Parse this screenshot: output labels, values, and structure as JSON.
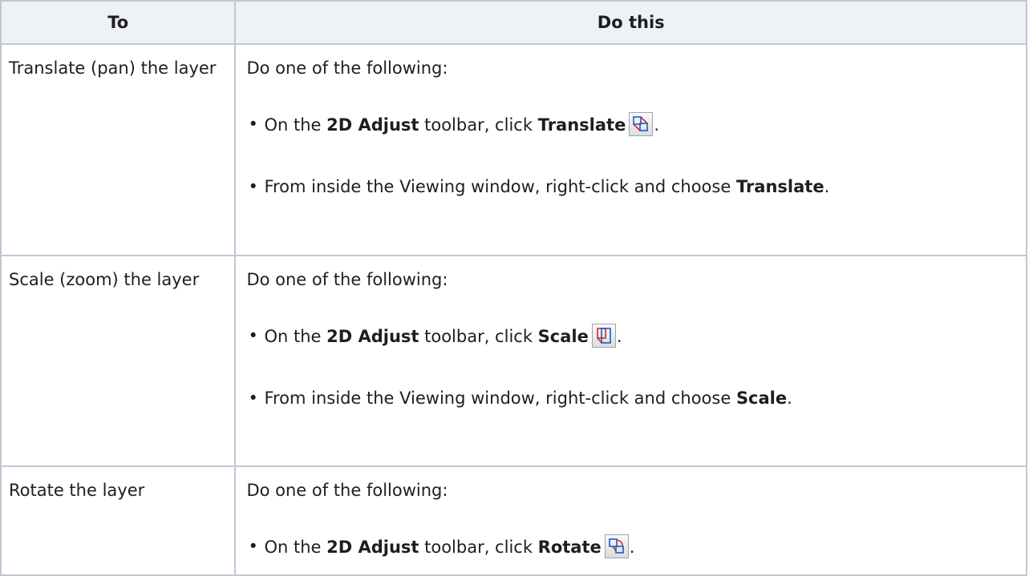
{
  "table": {
    "header": {
      "to": "To",
      "do_this": "Do this"
    },
    "rows": [
      {
        "to": "Translate (pan) the layer",
        "intro": "Do one of the following:",
        "b1": {
          "pre": "On the ",
          "bold1": "2D Adjust",
          "mid": " toolbar, click ",
          "bold2": "Translate",
          "icon": "translate-icon",
          "post": "."
        },
        "b2": {
          "pre": "From inside the Viewing window, right-click and choose ",
          "bold": "Translate",
          "post": "."
        }
      },
      {
        "to": "Scale (zoom) the layer",
        "intro": "Do one of the following:",
        "b1": {
          "pre": "On the ",
          "bold1": "2D Adjust",
          "mid": " toolbar, click ",
          "bold2": "Scale",
          "icon": "scale-icon",
          "post": "."
        },
        "b2": {
          "pre": "From inside the Viewing window, right-click and choose ",
          "bold": "Scale",
          "post": "."
        }
      },
      {
        "to": "Rotate the layer",
        "intro": "Do one of the following:",
        "b1": {
          "pre": "On the ",
          "bold1": "2D Adjust",
          "mid": " toolbar, click ",
          "bold2": "Rotate",
          "icon": "rotate-icon",
          "post": "."
        }
      }
    ]
  },
  "bullet_glyph": "•",
  "colors": {
    "border": "#bfc7d3",
    "header_bg": "#eef1f5",
    "icon_blue": "#1a5bc9",
    "icon_red": "#d42b2b"
  }
}
